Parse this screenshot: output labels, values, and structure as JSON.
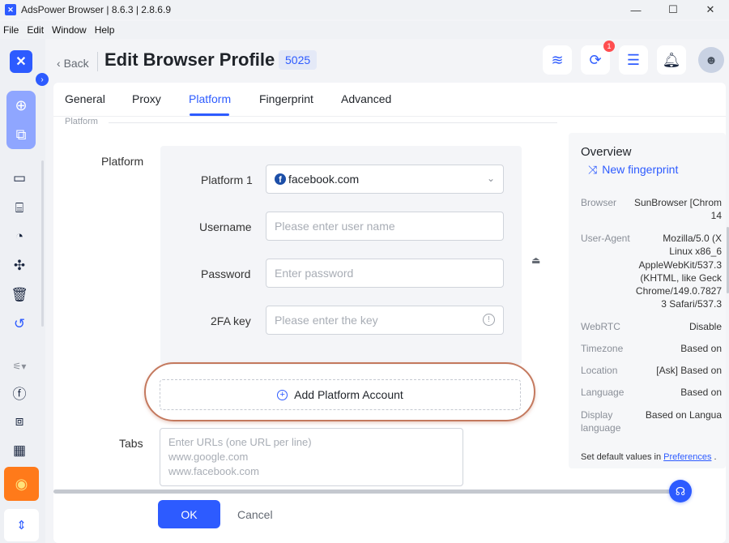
{
  "window": {
    "title": "AdsPower Browser | 8.6.3 | 2.8.6.9",
    "minimize": "—",
    "maximize": "☐",
    "close": "✕"
  },
  "menu": [
    "File",
    "Edit",
    "Window",
    "Help"
  ],
  "header": {
    "back_label": "Back",
    "title": "Edit Browser Profile",
    "profile_id": "5025",
    "notification_count": "1"
  },
  "tabs": [
    "General",
    "Proxy",
    "Platform",
    "Fingerprint",
    "Advanced"
  ],
  "active_tab": "Platform",
  "section": {
    "label": "Platform"
  },
  "form": {
    "platform_label": "Platform",
    "platform1_label": "Platform 1",
    "platform1_value": "facebook.com",
    "username_label": "Username",
    "username_placeholder": "Please enter user name",
    "password_label": "Password",
    "password_placeholder": "Enter password",
    "twofa_label": "2FA key",
    "twofa_placeholder": "Please enter the key",
    "add_account_label": "Add Platform Account",
    "tabs_label": "Tabs",
    "tabs_placeholder_lines": [
      "Enter URLs (one URL per line)",
      "www.google.com",
      "www.facebook.com"
    ]
  },
  "overview": {
    "title": "Overview",
    "new_fingerprint": "New fingerprint",
    "rows": [
      {
        "key": "Browser",
        "value": "SunBrowser [Chrom\n14"
      },
      {
        "key": "User-Agent",
        "value": "Mozilla/5.0 (X\nLinux x86_6\nAppleWebKit/537.3\n(KHTML, like Geck\nChrome/149.0.7827\n3 Safari/537.3"
      },
      {
        "key": "WebRTC",
        "value": "Disable"
      },
      {
        "key": "Timezone",
        "value": "Based on"
      },
      {
        "key": "Location",
        "value": "[Ask] Based on"
      },
      {
        "key": "Language",
        "value": "Based on"
      },
      {
        "key": "Display language",
        "value": "Based on Langua"
      }
    ],
    "footer_text": "Set default values in",
    "footer_link": "Preferences",
    "footer_end": "."
  },
  "actions": {
    "ok": "OK",
    "cancel": "Cancel"
  },
  "colors": {
    "accent": "#2d5bff",
    "highlight_ring": "#c4795e",
    "badge": "#ff4d4f"
  }
}
